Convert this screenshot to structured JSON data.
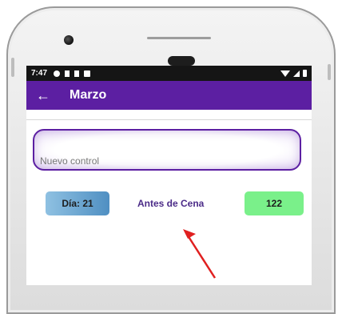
{
  "status_bar": {
    "time": "7:47"
  },
  "app_bar": {
    "title": "Marzo"
  },
  "control_input": {
    "placeholder": "Nuevo control"
  },
  "reading": {
    "day": "Día: 21",
    "moment": "Antes de Cena",
    "value": "122"
  },
  "colors": {
    "primary": "#5c1fa2",
    "value_badge": "#7af08a",
    "day_badge": "#4f8fc2",
    "annotation": "#e02020"
  }
}
